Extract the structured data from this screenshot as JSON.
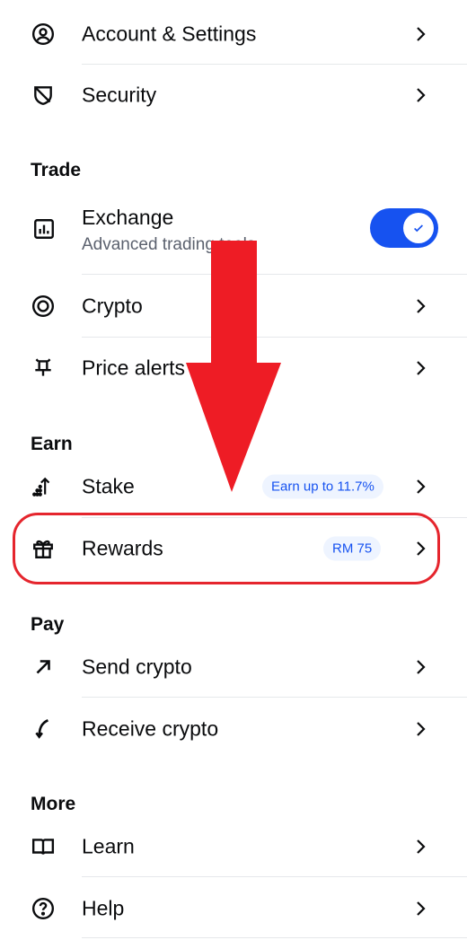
{
  "menu": {
    "account": {
      "label": "Account & Settings"
    },
    "security": {
      "label": "Security"
    },
    "trade_heading": "Trade",
    "exchange": {
      "label": "Exchange",
      "subtitle": "Advanced trading tools",
      "toggle_on": true
    },
    "crypto": {
      "label": "Crypto"
    },
    "price_alerts": {
      "label": "Price alerts"
    },
    "earn_heading": "Earn",
    "stake": {
      "label": "Stake",
      "badge": "Earn up to 11.7%"
    },
    "rewards": {
      "label": "Rewards",
      "badge": "RM 75"
    },
    "pay_heading": "Pay",
    "send": {
      "label": "Send crypto"
    },
    "receive": {
      "label": "Receive crypto"
    },
    "more_heading": "More",
    "learn": {
      "label": "Learn"
    },
    "help": {
      "label": "Help"
    }
  },
  "colors": {
    "accent": "#1652f0",
    "annotation": "#e5252d",
    "badge_bg": "#eef4ff",
    "subtitle": "#5b616e"
  },
  "icons": [
    "user-circle-icon",
    "shield-icon",
    "chart-icon",
    "crypto-coin-icon",
    "bell-icon",
    "stake-icon",
    "gift-icon",
    "send-arrow-icon",
    "receive-arrow-icon",
    "book-icon",
    "help-icon",
    "chevron-right-icon",
    "check-icon"
  ]
}
